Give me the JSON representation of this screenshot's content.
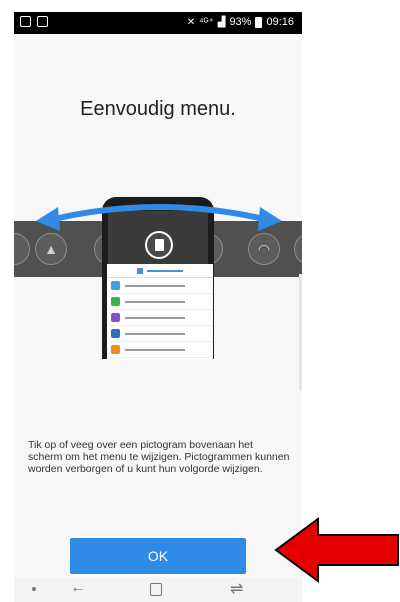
{
  "status_bar": {
    "signal_text": "⁴ᴳ⁺",
    "battery": "93%",
    "time": "09:16"
  },
  "title": "Eenvoudig menu.",
  "description": "Tik op of veeg over een pictogram bovenaan het scherm om het menu te wijzigen. Pictogrammen kunnen worden verborgen of u kunt hun volgorde wijzigen.",
  "ok_label": "OK",
  "icons": {
    "band": [
      "drive-icon",
      "dropbox-icon",
      "document-icon",
      "screen-icon",
      "wifi-icon"
    ],
    "navigation": [
      "dot-icon",
      "back-icon",
      "home-icon",
      "recent-apps-icon"
    ]
  },
  "colors": {
    "ok_button": "#2f8be6",
    "band": "#505050",
    "swipe_arrow": "#2f8be6",
    "callout_arrow": "#e60000"
  }
}
